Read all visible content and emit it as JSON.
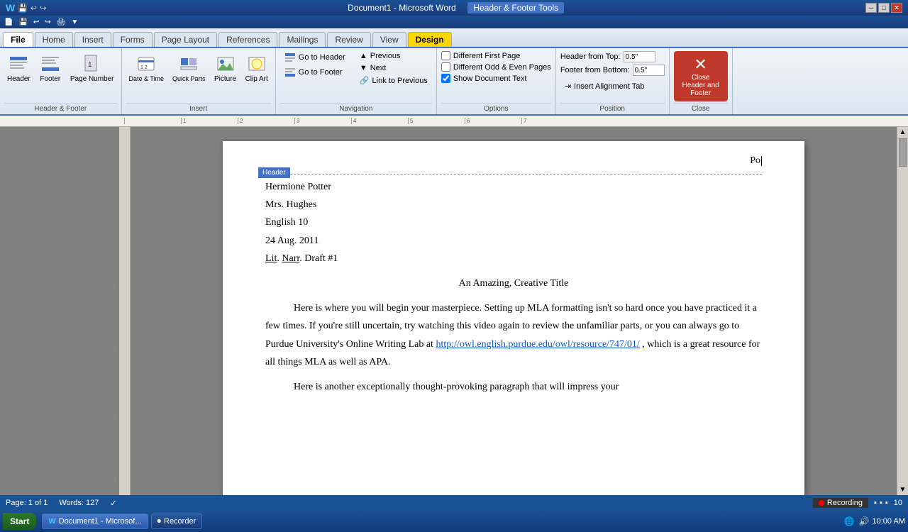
{
  "titlebar": {
    "title": "Document1 - Microsoft Word",
    "header_footer_tools": "Header & Footer Tools"
  },
  "tabs": {
    "items": [
      "File",
      "Home",
      "Insert",
      "Forms",
      "Page Layout",
      "References",
      "Mailings",
      "Review",
      "View",
      "Design"
    ]
  },
  "ribbon": {
    "groups": {
      "header_footer": {
        "label": "Header & Footer",
        "header_btn": "Header",
        "footer_btn": "Footer",
        "page_number_btn": "Page Number"
      },
      "insert": {
        "label": "Insert",
        "date_time": "Date & Time",
        "quick_parts": "Quick Parts",
        "picture": "Picture",
        "clip_art": "Clip Art"
      },
      "navigation": {
        "label": "Navigation",
        "previous": "Previous",
        "next": "Next",
        "link_to_previous": "Link to Previous",
        "go_to_header": "Go to Header",
        "go_to_footer": "Go to Footer"
      },
      "options": {
        "label": "Options",
        "different_first_page": "Different First Page",
        "different_odd_even": "Different Odd & Even Pages",
        "show_document_text": "Show Document Text"
      },
      "position": {
        "label": "Position",
        "header_from_top_label": "Header from Top:",
        "header_from_top_value": "0.5\"",
        "footer_from_bottom_label": "Footer from Bottom:",
        "footer_from_bottom_value": "0.5\"",
        "insert_alignment_tab": "Insert Alignment Tab"
      },
      "close": {
        "label": "Close",
        "btn": "Close Header and Footer"
      }
    }
  },
  "document": {
    "page_number": "Po",
    "header_label": "Header",
    "author": "Hermione Potter",
    "teacher": "Mrs. Hughes",
    "class": "English 10",
    "date": "24 Aug. 2011",
    "assignment": "Lit. Narr. Draft #1",
    "title": "An Amazing, Creative Title",
    "paragraph1": "Here is where you will begin your masterpiece. Setting up MLA formatting isn't so hard once you have practiced it a few times. If you're still uncertain, try watching this video again to review the unfamiliar parts, or you can always go to Purdue University's Online Writing Lab at",
    "link": "http://owl.english.purdue.edu/owl/resource/747/01/",
    "paragraph1_continued": ", which is a great resource for all things MLA as well as APA.",
    "paragraph2_start": "Here is another exceptionally thought-provoking paragraph that will impress your"
  },
  "statusbar": {
    "page": "Page: 1 of 1",
    "words": "Words: 127",
    "recording": "Recording"
  },
  "taskbar": {
    "start": "Start",
    "items": [
      "Document1 - Microsof...",
      "Recorder"
    ],
    "time": "10"
  }
}
